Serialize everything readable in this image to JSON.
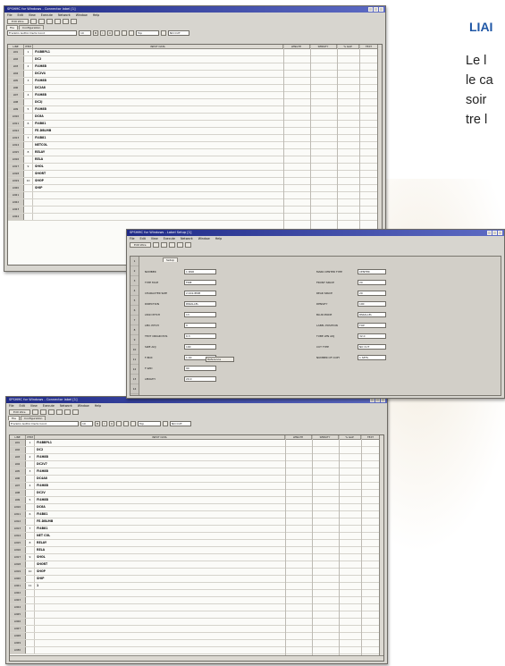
{
  "side_text": {
    "heading": "LIAI",
    "lines": [
      "Le l",
      "le ca",
      "soir",
      "tre l"
    ]
  },
  "win1": {
    "title": "SPSHMC for Windows - Connector label [1]",
    "menu": [
      "File",
      "Edit",
      "View",
      "Execute",
      "Network",
      "Window",
      "Help"
    ],
    "toolbar_button": "Edit Wire",
    "tabs": [
      "File",
      "Configuration"
    ],
    "font_name": "Franklin Gothic Demi Cond",
    "font_size": "10",
    "align_value": "Top",
    "nocut_label": "NO CUT",
    "columns": [
      "LINE",
      "ITEM",
      "INPUT DATA",
      "LENGTH",
      "SENSITY",
      "% GAP",
      "TEXT"
    ],
    "rows": [
      {
        "line": "LN1",
        "num": "1",
        "text": "FI4BBPL1"
      },
      {
        "line": "LN2",
        "num": "",
        "text": "DC2"
      },
      {
        "line": "LN3",
        "num": "2",
        "text": "FI4H8B"
      },
      {
        "line": "LN4",
        "num": "",
        "text": "DC2V4"
      },
      {
        "line": "LN5",
        "num": "3",
        "text": "FI4H8B"
      },
      {
        "line": "LN6",
        "num": "",
        "text": "DC2A8"
      },
      {
        "line": "LN7",
        "num": "4",
        "text": "FI4H8B"
      },
      {
        "line": "LN8",
        "num": "",
        "text": "DC2J"
      },
      {
        "line": "LN9",
        "num": "5",
        "text": "FI4H8B"
      },
      {
        "line": "LN10",
        "num": "",
        "text": "DC6A"
      },
      {
        "line": "LN11",
        "num": "6",
        "text": "FI4B81"
      },
      {
        "line": "LN12",
        "num": "",
        "text": "FE.DBLMB"
      },
      {
        "line": "LN13",
        "num": "7",
        "text": "FI4B81"
      },
      {
        "line": "LN14",
        "num": "",
        "text": "NETCOL"
      },
      {
        "line": "LN15",
        "num": "8",
        "text": "RELAY"
      },
      {
        "line": "LN16",
        "num": "",
        "text": "RELA"
      },
      {
        "line": "LN17",
        "num": "9",
        "text": "SHOL"
      },
      {
        "line": "LN18",
        "num": "",
        "text": "SHORT"
      },
      {
        "line": "LN19",
        "num": "10",
        "text": "SHOP"
      },
      {
        "line": "LN20",
        "num": "",
        "text": "SHIP"
      },
      {
        "line": "LN21",
        "num": "",
        "text": ""
      },
      {
        "line": "LN22",
        "num": "",
        "text": ""
      },
      {
        "line": "LN23",
        "num": "",
        "text": ""
      },
      {
        "line": "LN24",
        "num": "",
        "text": ""
      }
    ]
  },
  "win2": {
    "title": "SPSHMC for Windows - Label Setup [1]",
    "menu": [
      "File",
      "Edit",
      "View",
      "Execute",
      "Network",
      "Window",
      "Help"
    ],
    "toolbar_button": "Edit Wire",
    "tab": "Setup",
    "row_nums": [
      "1",
      "2",
      "3",
      "4",
      "5",
      "6",
      "7",
      "8",
      "9",
      "10",
      "11",
      "12",
      "13",
      "14",
      "15"
    ],
    "left_fields": [
      {
        "label": "NUMBER",
        "value": "1 PAIR"
      },
      {
        "label": "TYPE FACE",
        "value": "FINE"
      },
      {
        "label": "CHARACTER SIZE",
        "value": "2.4X2.8MM"
      },
      {
        "label": "DIRECTION",
        "value": "PARALLEL"
      },
      {
        "label": "LEAD PITCH",
        "value": "13"
      },
      {
        "label": "LEN. PITCH",
        "value": "0"
      },
      {
        "label": "TEXT ORIGIN POS",
        "value": "0.3"
      },
      {
        "label": "SIZE ADJ",
        "value": "100"
      },
      {
        "label": "F-BOX",
        "value": "1.00"
      },
      {
        "label": "F-WID",
        "value": "90"
      },
      {
        "label": "LENGTH",
        "value": "20.0"
      }
    ],
    "right_fields": [
      {
        "label": "MARK CENTER TYPE",
        "value": "CENTER"
      },
      {
        "label": "FRONT SPACE",
        "value": "20"
      },
      {
        "label": "REAR SPACE",
        "value": "20"
      },
      {
        "label": "DENSITY",
        "value": "100"
      },
      {
        "label": "BLUR MODE",
        "value": "PARALLEL"
      },
      {
        "label": "LABEL POSITION",
        "value": "TOP"
      },
      {
        "label": "TUBE LEN ADJ",
        "value": "32.0"
      },
      {
        "label": "CUT TYPE",
        "value": "NO CUT"
      },
      {
        "label": "NUMBER OF COPY",
        "value": "1 SETS"
      }
    ],
    "extra_button": "Reference"
  },
  "win3": {
    "title": "SPSHMC for Windows - Connector label [1]",
    "menu": [
      "File",
      "Edit",
      "View",
      "Execute",
      "Network",
      "Window",
      "Help"
    ],
    "toolbar_button": "Edit Wire",
    "tabs": [
      "File",
      "Configuration"
    ],
    "font_name": "Franklin Gothic Demi Cond",
    "font_size": "10",
    "align_value": "Top",
    "nocut_label": "NO CUT",
    "columns": [
      "LINE",
      "ITEM",
      "INPUT DATA",
      "LENGTH",
      "SENSITY",
      "% GAP",
      "TEXT"
    ],
    "rows": [
      {
        "line": "LN1",
        "num": "1",
        "text": "FI4BBPL1"
      },
      {
        "line": "LN2",
        "num": "",
        "text": "DC2"
      },
      {
        "line": "LN3",
        "num": "2",
        "text": "FI4H8B"
      },
      {
        "line": "LN4",
        "num": "",
        "text": "DC2V7"
      },
      {
        "line": "LN5",
        "num": "3",
        "text": "FI4H8B"
      },
      {
        "line": "LN6",
        "num": "",
        "text": "DC4A8"
      },
      {
        "line": "LN7",
        "num": "4",
        "text": "FI4H8B"
      },
      {
        "line": "LN8",
        "num": "",
        "text": "DC2V"
      },
      {
        "line": "LN9",
        "num": "5",
        "text": "FI4H8B"
      },
      {
        "line": "LN10",
        "num": "",
        "text": "DC6A"
      },
      {
        "line": "LN11",
        "num": "6",
        "text": "FI4B81"
      },
      {
        "line": "LN12",
        "num": "",
        "text": "FE.DBLMB"
      },
      {
        "line": "LN13",
        "num": "7",
        "text": "FI4B81"
      },
      {
        "line": "LN14",
        "num": "",
        "text": "NET COL"
      },
      {
        "line": "LN15",
        "num": "8",
        "text": "RELAY"
      },
      {
        "line": "LN16",
        "num": "",
        "text": "RELA"
      },
      {
        "line": "LN17",
        "num": "9",
        "text": "SHOL"
      },
      {
        "line": "LN18",
        "num": "",
        "text": "SHORT"
      },
      {
        "line": "LN19",
        "num": "10",
        "text": "SHOP"
      },
      {
        "line": "LN20",
        "num": "",
        "text": "SHIP"
      },
      {
        "line": "LN21",
        "num": "11",
        "text": "1"
      },
      {
        "line": "LN22",
        "num": "",
        "text": ""
      },
      {
        "line": "LN23",
        "num": "",
        "text": ""
      },
      {
        "line": "LN24",
        "num": "",
        "text": ""
      },
      {
        "line": "LN25",
        "num": "",
        "text": ""
      },
      {
        "line": "LN26",
        "num": "",
        "text": ""
      },
      {
        "line": "LN27",
        "num": "",
        "text": ""
      },
      {
        "line": "LN28",
        "num": "",
        "text": ""
      },
      {
        "line": "LN29",
        "num": "",
        "text": ""
      },
      {
        "line": "LN30",
        "num": "",
        "text": ""
      }
    ]
  }
}
